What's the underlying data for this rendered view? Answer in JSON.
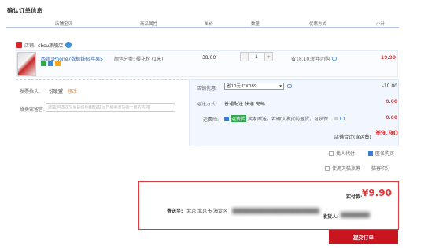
{
  "page_title": "确认订单信息",
  "columns": [
    "店铺宝贝",
    "商品属性",
    "单价",
    "数量",
    "优惠方式",
    "小计"
  ],
  "shop": {
    "prefix": "店铺:",
    "name": "cbsu旗舰店"
  },
  "item": {
    "name": "西顿1Phone7数据线6s苹果5",
    "attribute": "颜色分类: 樱花粉 (1米)",
    "price": "38.00",
    "quantity": "1",
    "minus": "-",
    "plus": "+",
    "promotion": "省18.10:新年团购",
    "subtotal": "19.90",
    "colors": {
      "accent": "#e4393c",
      "link": "#3366aa"
    }
  },
  "shipping_note": {
    "label": "发票抬头:",
    "value": "一份联盟",
    "extra": "修改"
  },
  "message": {
    "label": "给卖家留言:",
    "placeholder": "选填:可本次交易的说明(建议填写已和卖家协商一致的内容)"
  },
  "store_discount": {
    "label": "店铺优惠:",
    "selected": "省10元:DX089",
    "amount": "-10.00"
  },
  "delivery": {
    "label": "运送方式:",
    "value": "普通配送 快递 免邮",
    "amount": "0.00"
  },
  "insurance": {
    "label": "运费险:",
    "tag": "运费险",
    "text": "卖家赠送，若确认收货前退货，可获保...",
    "amount": "0.00"
  },
  "store_total": {
    "label": "店铺合计(含运费)",
    "value": "¥9.90"
  },
  "options": {
    "proxy_pay": "找人代付",
    "anonymous": "匿名购买",
    "tmall_points": "使用天猫点券",
    "points_link": "猫客积分"
  },
  "summary": {
    "paid_label": "实付款:",
    "paid_value": "¥9.90",
    "ship_to_label": "寄送至:",
    "ship_to_value": "北京 北京市 海淀区",
    "receiver_label": "收货人:"
  },
  "submit_label": "提交订单"
}
